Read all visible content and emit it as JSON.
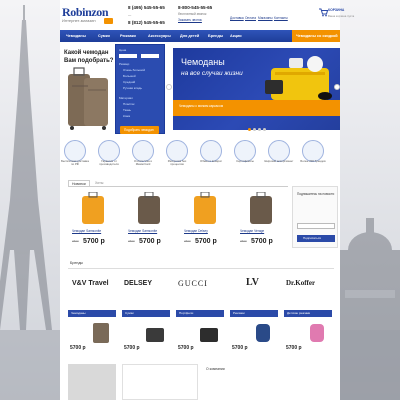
{
  "header": {
    "logo_text": "Robinzon",
    "tagline": "Интернет-магазин",
    "phone_1": "8 (495) 545-55-65",
    "phone_2": "8 (812) 545-55-65",
    "phone_3": "8-800-545-55-65",
    "free_call": "бесплатный звонок",
    "callback": "Заказать звонок",
    "top_links": [
      "Доставка",
      "Оплата",
      "Магазины",
      "Контакты"
    ],
    "search_placeholder": "",
    "cart_label": "КОРЗИНА",
    "cart_items": "Ваша корзина пуста"
  },
  "nav": {
    "items": [
      "Чемоданы",
      "Сумки",
      "Рюкзаки",
      "Аксессуары",
      "Для детей",
      "Бренды",
      "Акции"
    ],
    "sale": "Чемоданы со скидкой"
  },
  "filter": {
    "title_1": "Какой чемодан",
    "title_2": "Вам подобрать?",
    "label_price": "Цена",
    "label_size": "Размер",
    "sizes": [
      "Очень большой",
      "Большой",
      "Средний",
      "Ручная кладь"
    ],
    "label_material": "Материал",
    "materials": [
      "Пластик",
      "Ткань",
      "Кожа"
    ],
    "button": "Подобрать чемодан"
  },
  "banner": {
    "title": "Чемоданы",
    "subtitle": "на все случаи жизни",
    "strip_text": "Чемоданы с мягким каркасом",
    "dots": 4
  },
  "features": [
    "Бесплатная доставка по РФ",
    "Гарантия от производителя",
    "Оплата Visa и MasterCard",
    "Рассрочка без процентов",
    "Обмен и возврат",
    "Сертификаты",
    "Широкий ассортимент",
    "Более 200 брендов"
  ],
  "products": {
    "tab_new": "Новинки",
    "tab_hit": "Хиты",
    "items": [
      {
        "name": "Чемодан Samsonite",
        "old": "7800",
        "price": "5700 р",
        "color": "#f0a020"
      },
      {
        "name": "Чемодан Samsonite",
        "old": "7800",
        "price": "5700 р",
        "color": "#6a5a4a"
      },
      {
        "name": "Чемодан Delsey",
        "old": "7800",
        "price": "5700 р",
        "color": "#f0a020"
      },
      {
        "name": "Чемодан Verage",
        "old": "7800",
        "price": "5700 р",
        "color": "#6a5a4a"
      }
    ]
  },
  "subscribe": {
    "text": "Подпишитесь на новости",
    "button": "Подписаться"
  },
  "brands": {
    "title": "Бренды",
    "list": [
      "V&V Travel",
      "DELSEY",
      "GUCCI",
      "LV",
      "Dr.Koffer"
    ]
  },
  "categories": [
    {
      "title": "Чемоданы",
      "price": "5700 р"
    },
    {
      "title": "Сумки",
      "price": "5700 р"
    },
    {
      "title": "Портфели",
      "price": "5700 р"
    },
    {
      "title": "Рюкзаки",
      "price": "5700 р"
    },
    {
      "title": "Детские рюкзаки",
      "price": "5700 р"
    }
  ],
  "bottom": {
    "about_title": "О компании"
  }
}
